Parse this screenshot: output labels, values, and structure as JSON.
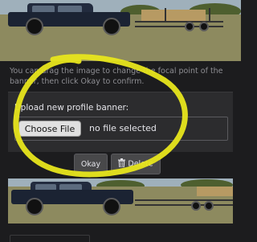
{
  "banner_editor": {
    "help_text": "You can drag the image to change the focal point of the banner, then click Okay to confirm.",
    "upload_label": "Upload new profile banner:",
    "file_input": {
      "button_label": "Choose File",
      "status": "no file selected"
    },
    "okay_label": "Okay",
    "delete_label": "Delete",
    "delete_icon": "trash-icon"
  },
  "colors": {
    "background": "#1c1c1e",
    "panel": "#2c2c2e",
    "highlight_annotation": "#e8e61c"
  }
}
